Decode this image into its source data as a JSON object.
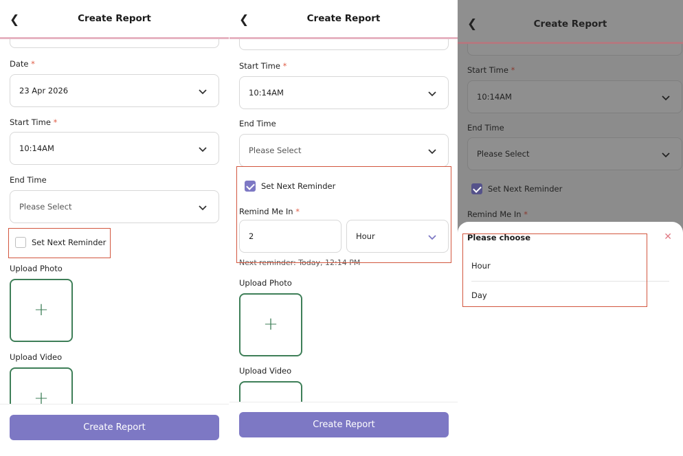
{
  "app": {
    "title": "Create Report",
    "back_icon": "chevron-left-icon"
  },
  "colors": {
    "accent": "#7d78c4",
    "upload_border": "#3d7e57",
    "required": "#e0604a",
    "highlight": "#d2553d",
    "header_line": "#e6b3c1"
  },
  "screen1": {
    "date_label": "Date",
    "date_value": "23 Apr 2026",
    "start_time_label": "Start Time",
    "start_time_value": "10:14AM",
    "end_time_label": "End Time",
    "end_time_placeholder": "Please Select",
    "reminder_label": "Set Next Reminder",
    "reminder_checked": false,
    "upload_photo_label": "Upload Photo",
    "upload_video_label": "Upload Video",
    "submit_label": "Create Report"
  },
  "screen2": {
    "start_time_label": "Start Time",
    "start_time_value": "10:14AM",
    "end_time_label": "End Time",
    "end_time_placeholder": "Please Select",
    "reminder_label": "Set Next Reminder",
    "reminder_checked": true,
    "remind_me_label": "Remind Me In",
    "remind_amount": "2",
    "remind_unit": "Hour",
    "next_reminder_text": "Next reminder: Today, 12:14 PM",
    "upload_photo_label": "Upload Photo",
    "upload_video_label": "Upload Video",
    "submit_label": "Create Report"
  },
  "screen3": {
    "start_time_label": "Start Time",
    "start_time_value": "10:14AM",
    "end_time_label": "End Time",
    "end_time_placeholder": "Please Select",
    "reminder_label": "Set Next Reminder",
    "reminder_checked": true,
    "remind_me_label": "Remind Me In",
    "sheet_title": "Please choose",
    "options": [
      "Hour",
      "Day"
    ]
  },
  "required_mark": "*"
}
